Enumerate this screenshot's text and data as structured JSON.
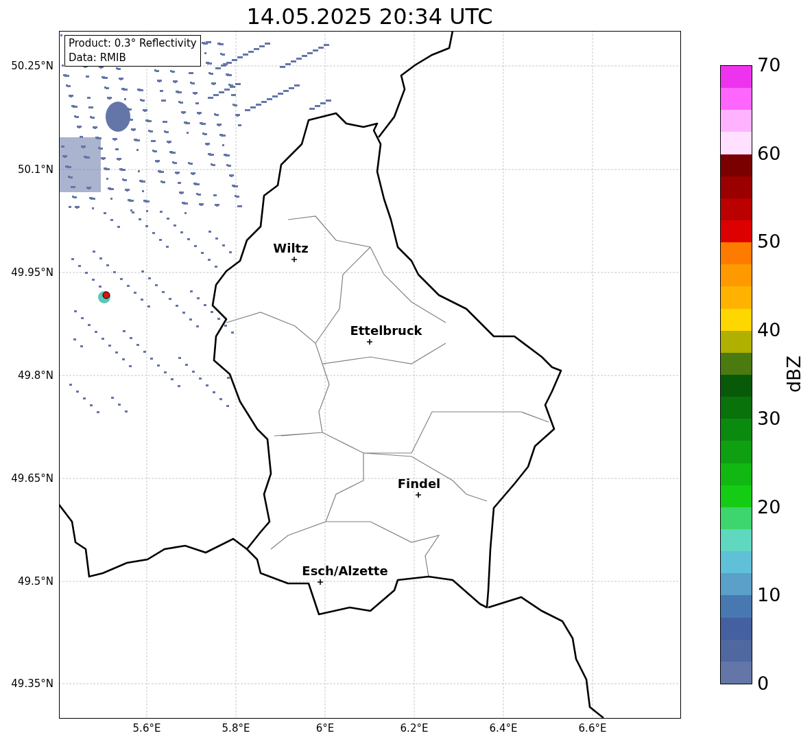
{
  "title": "14.05.2025 20:34 UTC",
  "legend": {
    "lines": [
      "Product: 0.3° Reflectivity",
      "Data: RMIB"
    ]
  },
  "map": {
    "cities": [
      {
        "name": "Wiltz"
      },
      {
        "name": "Ettelbruck"
      },
      {
        "name": "Findel"
      },
      {
        "name": "Esch/Alzette"
      }
    ],
    "lat_labels": [
      "50.25°N",
      "50.1°N",
      "49.95°N",
      "49.8°N",
      "49.65°N",
      "49.5°N",
      "49.35°N"
    ],
    "lon_labels": [
      "5.6°E",
      "5.8°E",
      "6°E",
      "6.2°E",
      "6.4°E",
      "6.6°E"
    ]
  },
  "colorbar": {
    "label": "dBZ",
    "ticks": [
      "70",
      "60",
      "50",
      "40",
      "30",
      "20",
      "10",
      "0"
    ],
    "bands": [
      {
        "color": "#6476a8"
      },
      {
        "color": "#5068a0"
      },
      {
        "color": "#4460a0"
      },
      {
        "color": "#4878b0"
      },
      {
        "color": "#5aa0c8"
      },
      {
        "color": "#60c0d8"
      },
      {
        "color": "#60d8c0"
      },
      {
        "color": "#3dd56d"
      },
      {
        "color": "#14cc14"
      },
      {
        "color": "#11b811"
      },
      {
        "color": "#0ea010"
      },
      {
        "color": "#0b8a10"
      },
      {
        "color": "#0a720a"
      },
      {
        "color": "#085a08"
      },
      {
        "color": "#4a7a10"
      },
      {
        "color": "#b0b000"
      },
      {
        "color": "#ffd700"
      },
      {
        "color": "#ffb300"
      },
      {
        "color": "#ff9900"
      },
      {
        "color": "#ff7b00"
      },
      {
        "color": "#dd0000"
      },
      {
        "color": "#bb0000"
      },
      {
        "color": "#9a0000"
      },
      {
        "color": "#7a0000"
      },
      {
        "color": "#ffe0ff"
      },
      {
        "color": "#ffb3ff"
      },
      {
        "color": "#ff66ff"
      },
      {
        "color": "#ee33ee"
      }
    ]
  }
}
